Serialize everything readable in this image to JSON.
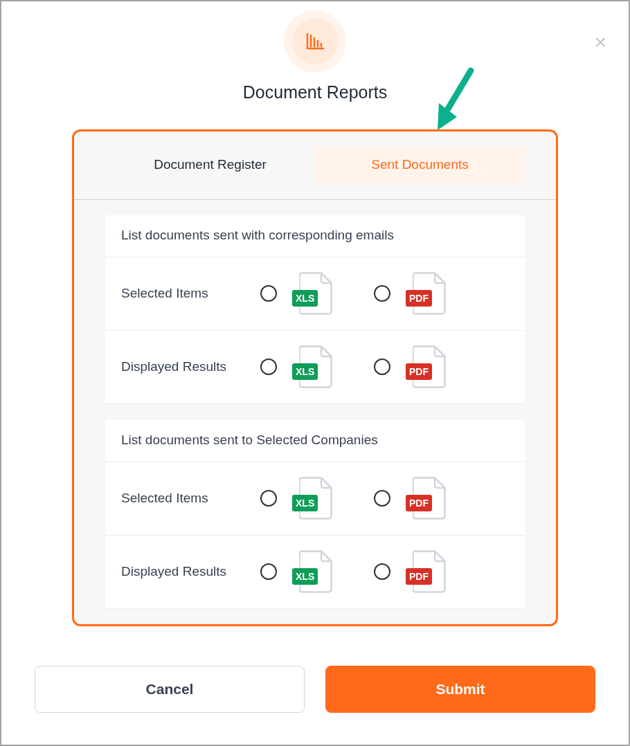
{
  "dialog": {
    "title": "Document Reports",
    "close": "×"
  },
  "tabs": [
    {
      "label": "Document Register",
      "selected": false
    },
    {
      "label": "Sent Documents",
      "selected": true
    }
  ],
  "sections": [
    {
      "title": "List documents sent with corresponding emails",
      "rows": [
        {
          "label": "Selected Items",
          "options": [
            {
              "kind": "xls",
              "badge": "XLS",
              "selected": false
            },
            {
              "kind": "pdf",
              "badge": "PDF",
              "selected": false
            }
          ]
        },
        {
          "label": "Displayed Results",
          "options": [
            {
              "kind": "xls",
              "badge": "XLS",
              "selected": false
            },
            {
              "kind": "pdf",
              "badge": "PDF",
              "selected": false
            }
          ]
        }
      ]
    },
    {
      "title": "List documents sent to Selected Companies",
      "rows": [
        {
          "label": "Selected Items",
          "options": [
            {
              "kind": "xls",
              "badge": "XLS",
              "selected": false
            },
            {
              "kind": "pdf",
              "badge": "PDF",
              "selected": false
            }
          ]
        },
        {
          "label": "Displayed Results",
          "options": [
            {
              "kind": "xls",
              "badge": "XLS",
              "selected": false
            },
            {
              "kind": "pdf",
              "badge": "PDF",
              "selected": false
            }
          ]
        }
      ]
    }
  ],
  "buttons": [
    {
      "kind": "secondary",
      "label": "Cancel"
    },
    {
      "kind": "primary",
      "label": "Submit"
    }
  ]
}
